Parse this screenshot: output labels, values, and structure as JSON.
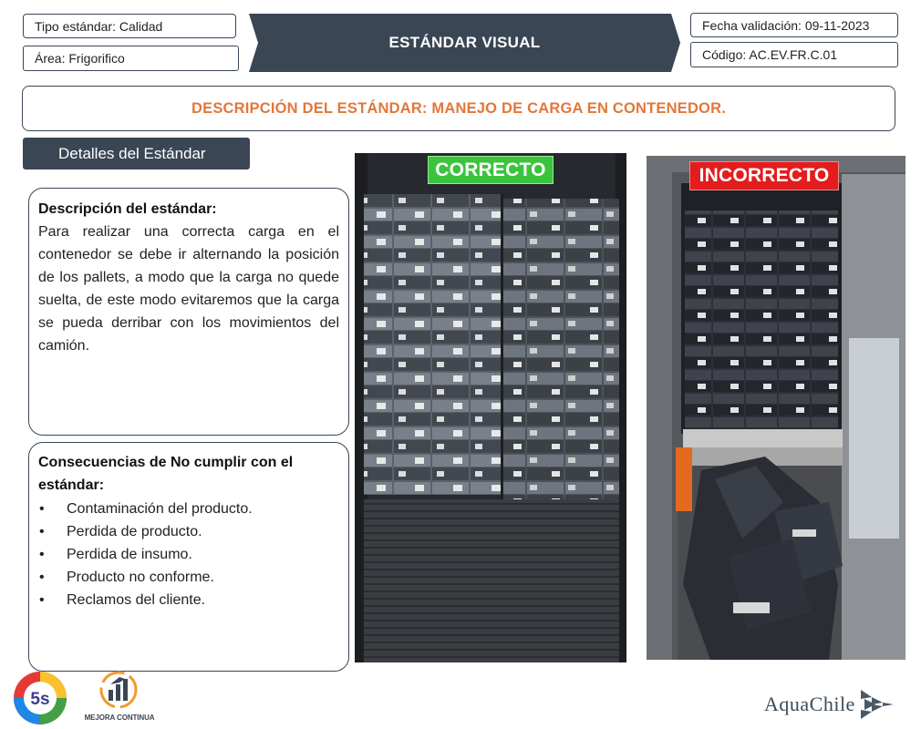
{
  "header": {
    "tipo_estandar": "Tipo estándar: Calidad",
    "area": "Área:  Frigorifico",
    "banner_title": "ESTÁNDAR VISUAL",
    "fecha_validacion": "Fecha validación: 09-11-2023",
    "codigo": "Código: AC.EV.FR.C.01"
  },
  "description_title": "DESCRIPCIÓN DEL ESTÁNDAR: MANEJO DE CARGA EN CONTENEDOR.",
  "details_tab": "Detalles del Estándar",
  "standard_description": {
    "heading": "Descripción del estándar:",
    "body": "Para realizar una correcta carga en el contenedor se debe ir alternando la posición de los pallets, a modo que la carga no quede suelta, de este modo evitaremos que la carga se pueda derribar con los movimientos del camión."
  },
  "consequences": {
    "heading": "Consecuencias de No cumplir con el estándar:",
    "items": [
      "Contaminación del producto.",
      "Perdida de producto.",
      "Perdida de insumo.",
      "Producto no conforme.",
      "Reclamos del cliente."
    ]
  },
  "photos": {
    "correct_label": "CORRECTO",
    "incorrect_label": "INCORRECTO"
  },
  "footer": {
    "logo_5s_text": "5s",
    "mejora_text": "MEJORA CONTINUA",
    "brand": "AquaChile"
  },
  "colors": {
    "dark_slate": "#3b4654",
    "orange_title": "#e2773a",
    "correct_green": "#3bc43b",
    "incorrect_red": "#e31d1d"
  }
}
